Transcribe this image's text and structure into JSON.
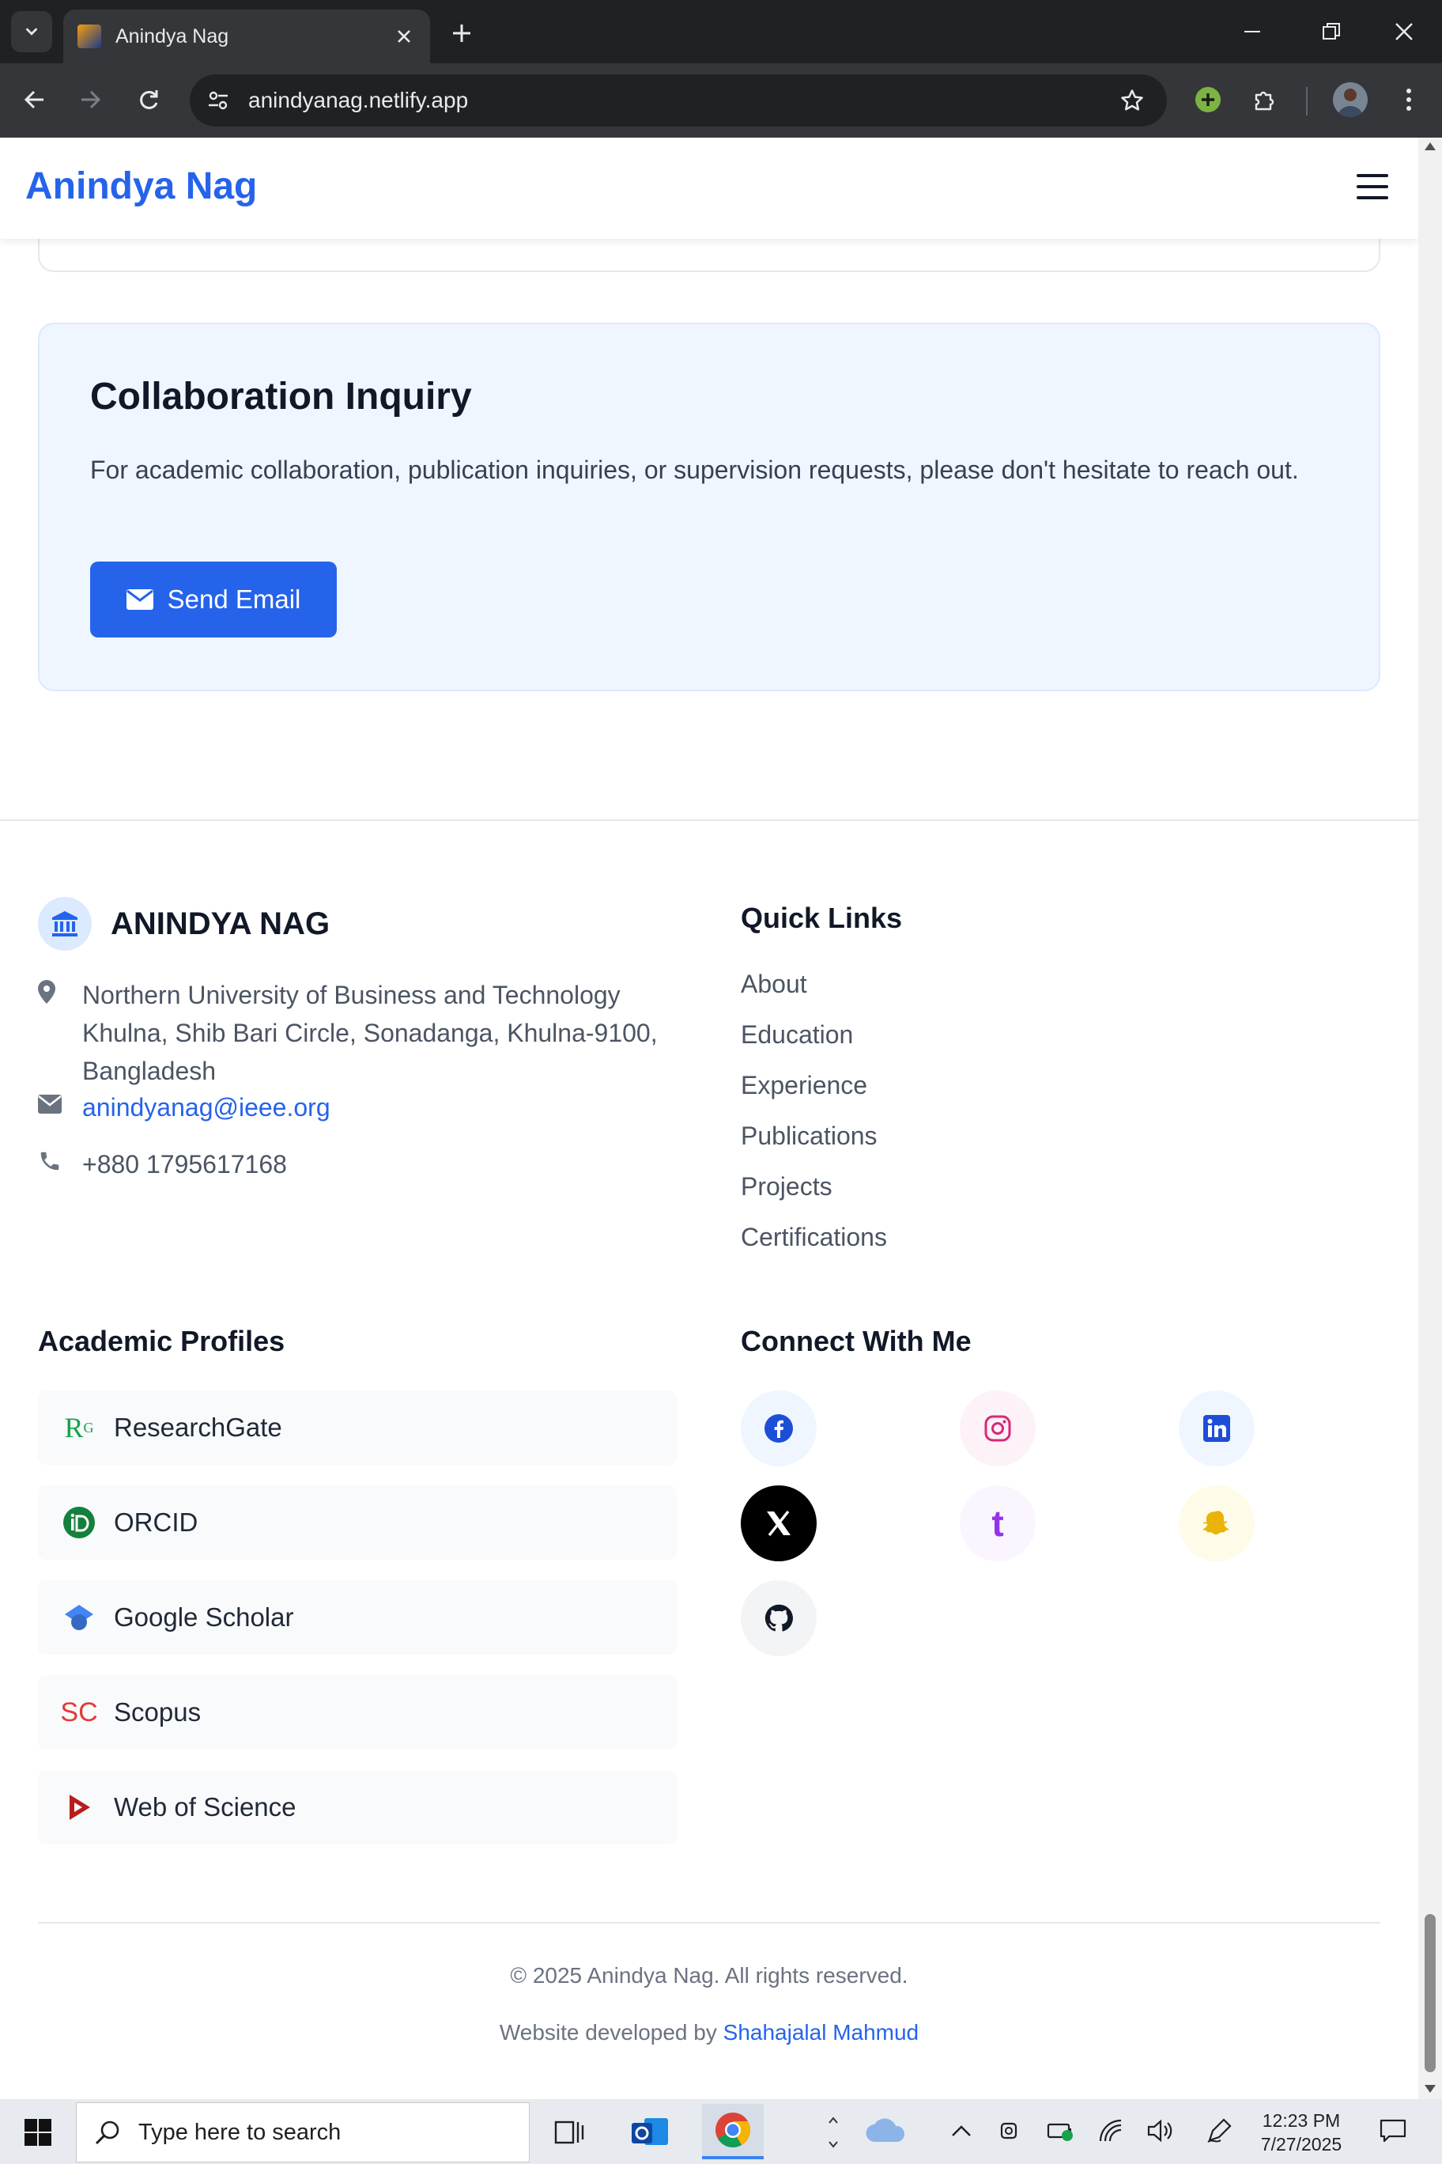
{
  "browser": {
    "tab_title": "Anindya Nag",
    "url": "anindyanag.netlify.app"
  },
  "site": {
    "brand": "Anindya Nag",
    "brand_color": "#2563eb"
  },
  "collab": {
    "title": "Collaboration Inquiry",
    "text": "For academic collaboration, publication inquiries, or supervision requests, please don't hesitate to reach out.",
    "button": "Send Email"
  },
  "footer": {
    "brand": "ANINDYA NAG",
    "address": "Northern University of Business and Technology Khulna, Shib Bari Circle, Sonadanga, Khulna-9100, Bangladesh",
    "email": "anindyanag@ieee.org",
    "phone": "+880 1795617168",
    "quick_links_title": "Quick Links",
    "quick_links": [
      "About",
      "Education",
      "Experience",
      "Publications",
      "Projects",
      "Certifications"
    ],
    "profiles_title": "Academic Profiles",
    "profiles": [
      "ResearchGate",
      "ORCID",
      "Google Scholar",
      "Scopus",
      "Web of Science"
    ],
    "researchgate_glyph": "R",
    "researchgate_sup": "G",
    "scopus_glyph": "SC",
    "connect_title": "Connect With Me",
    "social": [
      "facebook-icon",
      "instagram-icon",
      "linkedin-icon",
      "x-icon",
      "tumblr-icon",
      "snapchat-icon",
      "github-icon"
    ],
    "tumblr_glyph": "t",
    "copyright": "© 2025 Anindya Nag. All rights reserved.",
    "developed_by": "Website developed by",
    "developer": "Shahajalal Mahmud"
  },
  "taskbar": {
    "search_placeholder": "Type here to search",
    "time": "12:23 PM",
    "date": "7/27/2025"
  }
}
